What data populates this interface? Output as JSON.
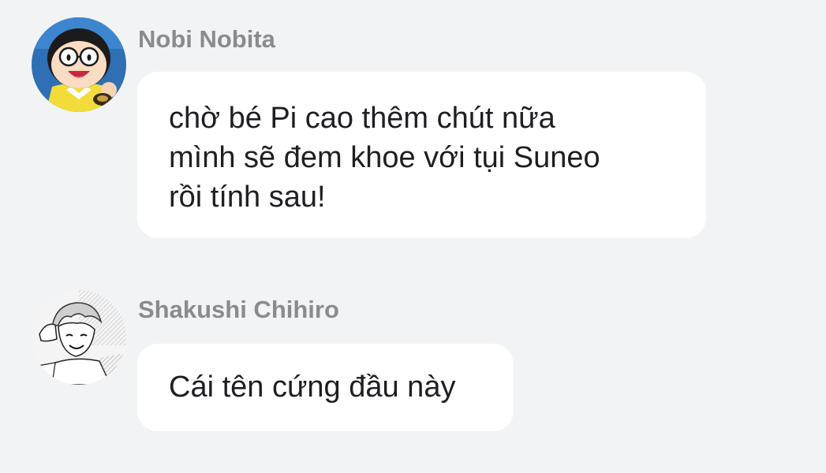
{
  "messages": [
    {
      "sender": "Nobi Nobita",
      "avatar_icon": "nobita-avatar",
      "lines": [
        "chờ bé Pi cao thêm chút nữa",
        "mình sẽ đem khoe với tụi Suneo",
        "rồi tính sau!"
      ]
    },
    {
      "sender": "Shakushi Chihiro",
      "avatar_icon": "manga-sketch-avatar",
      "lines": [
        "Cái tên cứng đầu này"
      ]
    }
  ],
  "colors": {
    "background": "#f2f3f5",
    "bubble": "#ffffff",
    "sender_name": "#8a8b8e",
    "message_text": "#1e1f22"
  }
}
